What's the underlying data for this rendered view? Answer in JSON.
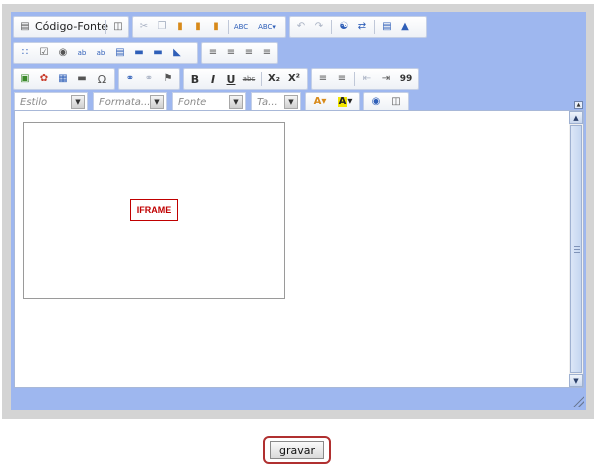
{
  "toolbar": {
    "source_label": "Código-Fonte",
    "row1": [
      "source-icon",
      "preview-icon",
      "cut-icon",
      "copy-icon",
      "paste-icon",
      "paste-text-icon",
      "paste-word-icon",
      "spellcheck-icon",
      "spellcheck-as-you-type-icon",
      "undo-icon",
      "redo-icon",
      "find-icon",
      "replace-icon",
      "select-all-icon",
      "remove-format-icon"
    ],
    "row2": [
      "form-icon",
      "checkbox-icon",
      "radio-icon",
      "textfield-icon",
      "textarea-icon",
      "select-icon",
      "button-icon",
      "image-button-icon",
      "hidden-field-icon",
      "align-left-icon",
      "align-center-icon",
      "align-right-icon",
      "justify-icon"
    ],
    "row3": [
      "image-icon",
      "flash-icon",
      "table-icon",
      "horizontal-rule-icon",
      "special-char-icon",
      "link-icon",
      "unlink-icon",
      "anchor-icon",
      "bold-icon",
      "italic-icon",
      "underline-icon",
      "strike-icon",
      "subscript-icon",
      "superscript-icon",
      "numbered-list-icon",
      "bulleted-list-icon",
      "outdent-icon",
      "indent-icon",
      "blockquote-icon"
    ],
    "row3_labels": {
      "bold": "B",
      "italic": "I",
      "underline": "U",
      "strike": "abc",
      "subscript": "X₂",
      "superscript": "X²",
      "special_char": "Ω",
      "blockquote": "99"
    },
    "combos": [
      {
        "name": "style",
        "placeholder": "Estilo"
      },
      {
        "name": "format",
        "placeholder": "Formata..."
      },
      {
        "name": "font",
        "placeholder": "Fonte"
      },
      {
        "name": "size",
        "placeholder": "Ta..."
      }
    ],
    "row4_icons": [
      "text-color-icon",
      "background-color-icon",
      "maximize-icon",
      "show-blocks-icon"
    ]
  },
  "content": {
    "iframe_label": "IFRAME"
  },
  "save_button": {
    "label": "gravar"
  },
  "colors": {
    "frame": "#d4d4d4",
    "editor_bg": "#9eb7ef",
    "iframe_tag": "#c00000",
    "save_outline": "#b03030"
  }
}
